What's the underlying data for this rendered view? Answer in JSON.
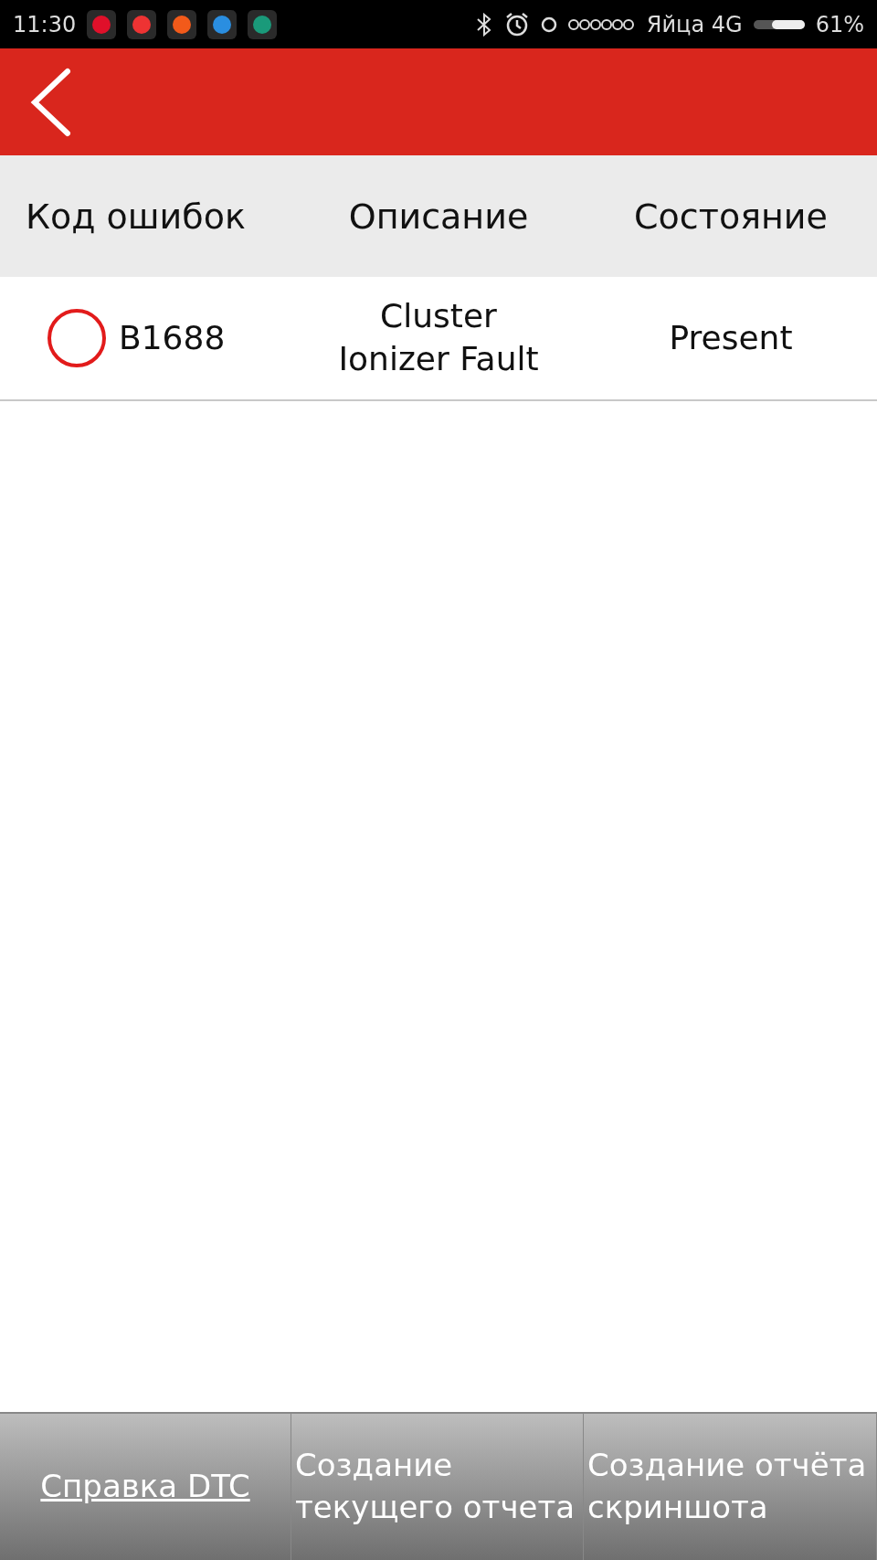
{
  "status_bar": {
    "time": "11:30",
    "carrier": "Яйца 4G",
    "battery": "61%"
  },
  "table": {
    "columns": [
      "Код ошибок",
      "Описание",
      "Состояние"
    ],
    "rows": [
      {
        "selected": false,
        "code": "B1688",
        "description": "Cluster Ionizer Fault",
        "state": "Present"
      }
    ]
  },
  "buttons": [
    {
      "label": "Справка DTC",
      "kind": "link"
    },
    {
      "label": "Создание текущего отчета",
      "kind": "plain"
    },
    {
      "label": "Создание отчёта скриншота",
      "kind": "plain"
    }
  ]
}
